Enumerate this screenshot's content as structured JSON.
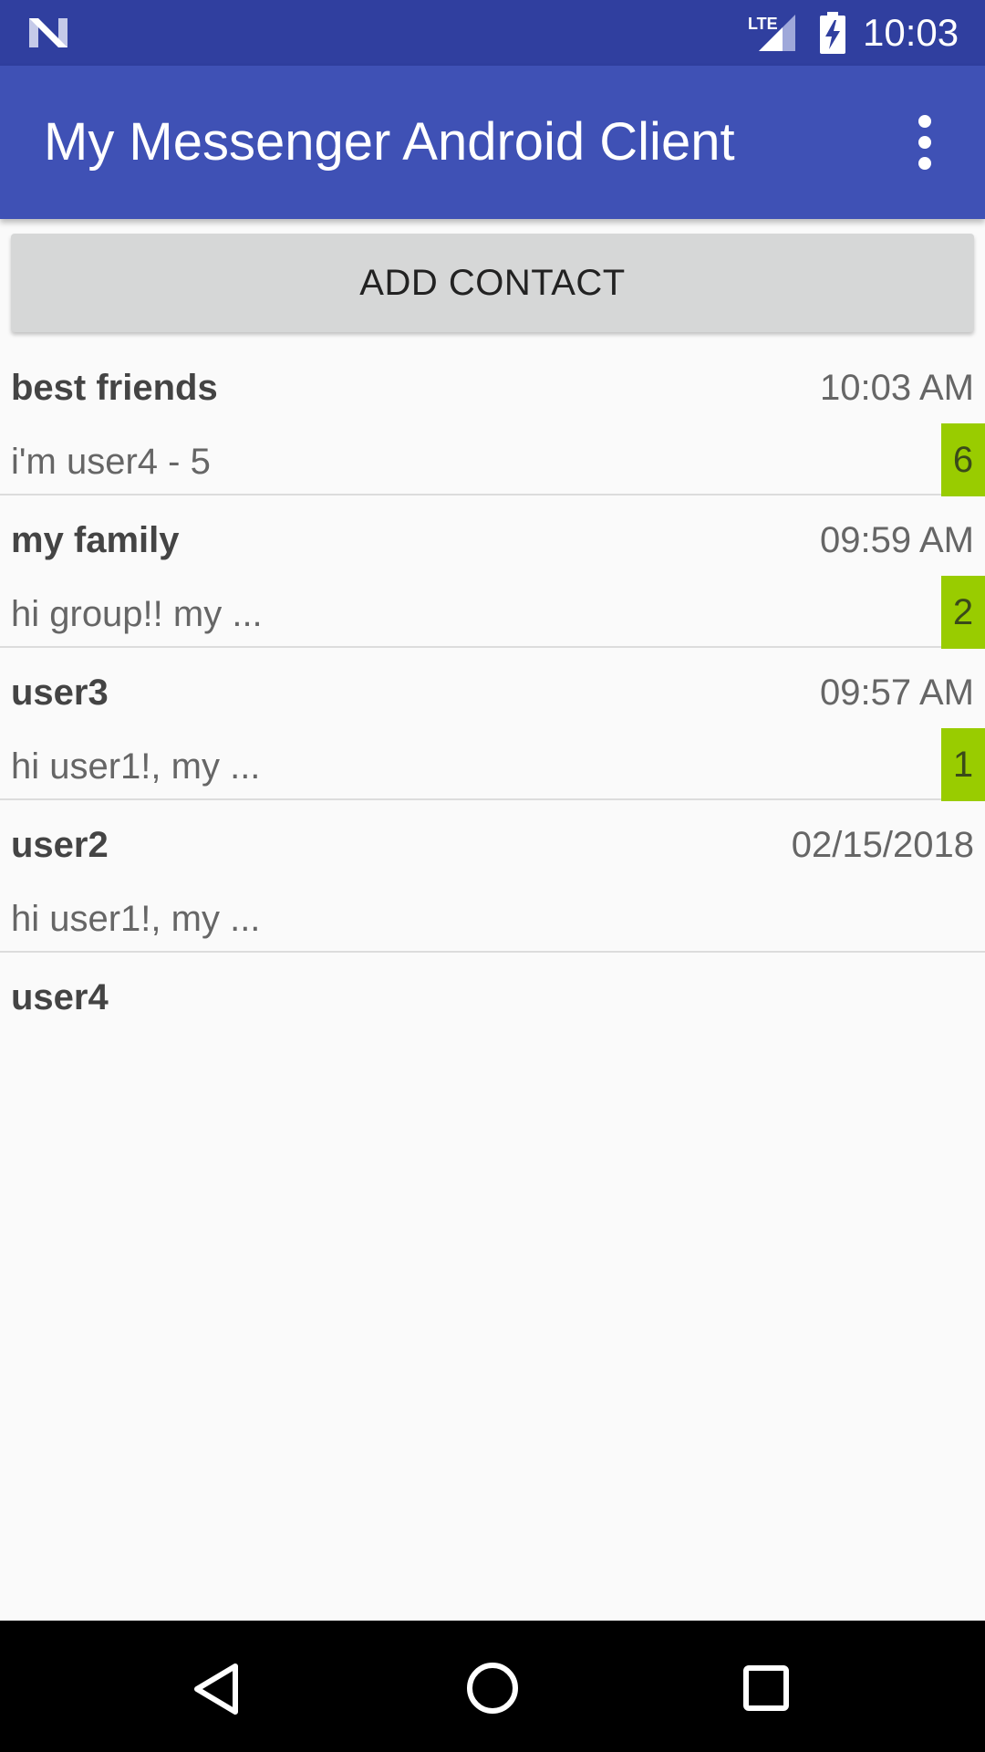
{
  "status_bar": {
    "time": "10:03",
    "network": "LTE",
    "icons": [
      "notification-logo-icon",
      "lte-signal-icon",
      "battery-charging-icon"
    ]
  },
  "app_bar": {
    "title": "My Messenger Android Client",
    "overflow_icon": "more-vert-icon"
  },
  "actions": {
    "add_contact_label": "ADD CONTACT"
  },
  "colors": {
    "status_bar": "#303f9f",
    "app_bar": "#3f51b5",
    "unread_badge": "#99cc00",
    "button": "#d6d7d7"
  },
  "chats": [
    {
      "name": "best friends",
      "time": "10:03 AM",
      "preview": "i'm user4 - 5",
      "unread": "6"
    },
    {
      "name": "my family",
      "time": "09:59 AM",
      "preview": "hi group!! my ...",
      "unread": "2"
    },
    {
      "name": "user3",
      "time": "09:57 AM",
      "preview": "hi user1!, my ...",
      "unread": "1"
    },
    {
      "name": "user2",
      "time": "02/15/2018",
      "preview": "hi user1!, my ...",
      "unread": ""
    },
    {
      "name": "user4",
      "time": "",
      "preview": "",
      "unread": ""
    }
  ],
  "nav_bar": {
    "icons": [
      "back-icon",
      "home-icon",
      "recents-icon"
    ]
  }
}
